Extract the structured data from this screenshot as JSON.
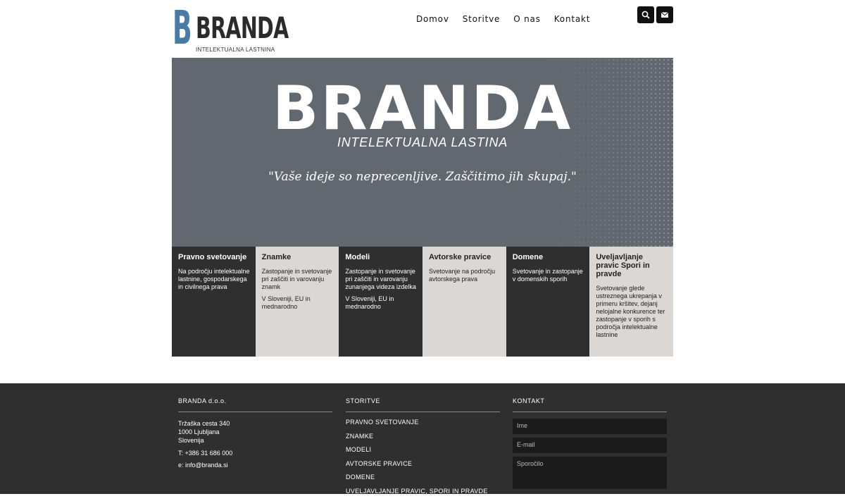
{
  "brand": {
    "logo_letter": "B",
    "name": "BRANDA",
    "tagline": "INTELEKTUALNA LASTNINA",
    "accent": "#4a7aa6"
  },
  "nav": {
    "items": [
      "Domov",
      "Storitve",
      "O nas",
      "Kontakt"
    ]
  },
  "header_icons": [
    "search-icon",
    "envelope-icon"
  ],
  "hero": {
    "title": "BRANDA",
    "subtitle": "INTELEKTUALNA LASTINA",
    "quote": "\"Vaše ideje so neprecenljive. Zaščitimo jih skupaj.\"",
    "background": "#62686f"
  },
  "services": [
    {
      "title": "Pravno svetovanje",
      "lines": [
        "Na področju intelektualne lastnine, gospodarskega in civilnega prava"
      ]
    },
    {
      "title": "Znamke",
      "lines": [
        "Zastopanje in svetovanje pri zaščiti in varovanju znamk",
        "V Sloveniji, EU in mednarodno"
      ]
    },
    {
      "title": "Modeli",
      "lines": [
        "Zastopanje in svetovanje pri zaščiti in varovanju zunanjega videza izdelka",
        "V Sloveniji, EU in mednarodno"
      ]
    },
    {
      "title": "Avtorske pravice",
      "lines": [
        "Svetovanje na področju avtorskega prava"
      ]
    },
    {
      "title": "Domene",
      "lines": [
        "Svetovanje in zastopanje v domenskih sporih"
      ]
    },
    {
      "title": "Uveljavljanje pravic Spori in pravde",
      "lines": [
        "Svetovanje glede ustreznega ukrepanja v primeru kršitev, dejanj nelojalne konkurence ter zastopanje v sporih s področja intelektualne lastnine"
      ]
    }
  ],
  "footer": {
    "company": {
      "heading": "BRANDA d.o.o.",
      "address": [
        "Tržaška cesta 340",
        "1000 Ljubljana",
        "Slovenija"
      ],
      "phone": " T: +386 31 686 000",
      "email": "e: info@branda.si"
    },
    "services": {
      "heading": "STORITVE",
      "items": [
        "PRAVNO SVETOVANJE",
        "ZNAMKE",
        "MODELI",
        "AVTORSKE PRAVICE",
        "DOMENE",
        "UVELJAVLJANJE PRAVIC, SPORI IN PRAVDE"
      ]
    },
    "contact": {
      "heading": "KONTAKT",
      "name_placeholder": "Ime",
      "email_placeholder": "E-mail",
      "message_placeholder": "Sporočilo"
    }
  }
}
